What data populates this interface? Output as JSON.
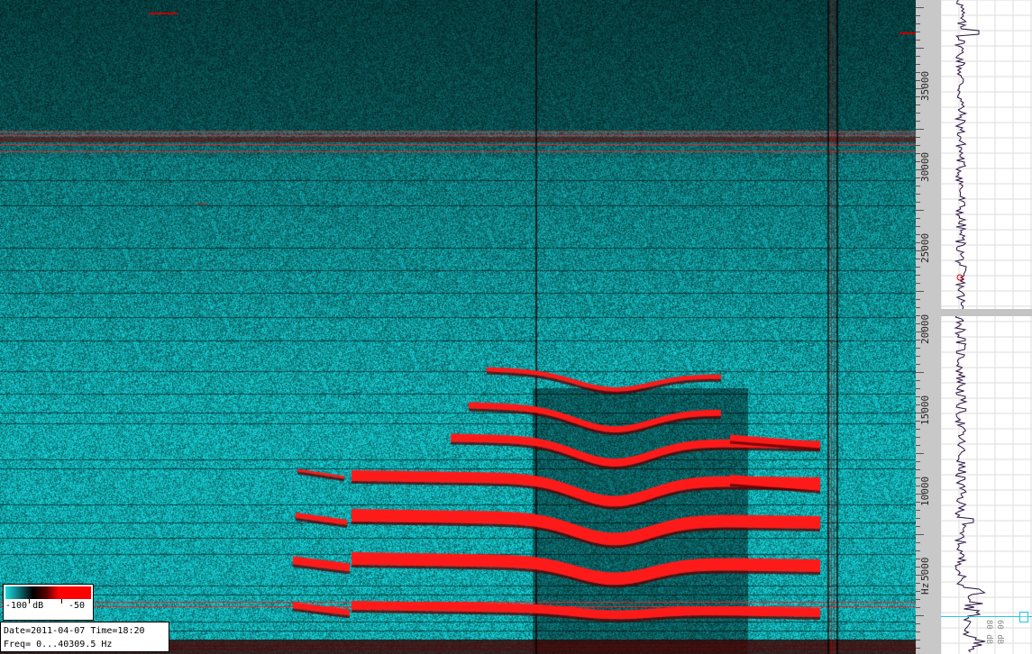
{
  "freq_scale": {
    "labels": [
      "35000",
      "30000",
      "25000",
      "20000",
      "15000",
      "10000",
      "5000"
    ],
    "unit": "Hz"
  },
  "legend": {
    "min_label": "-100 dB",
    "max_label": "-50",
    "colors": [
      "#1adfe0",
      "#0e7f85",
      "#000000",
      "#5a0000",
      "#ff0000"
    ]
  },
  "info": {
    "line1": "Date=2011-04-07 Time=18:20",
    "line2": "Freq= 0...40309.5 Hz"
  },
  "spectrum_panel": {
    "db_labels": [
      "60 dB",
      "80 dB"
    ]
  },
  "colors": {
    "background_cyan": "#18b7bd",
    "noise_dark": "#0b3a3f",
    "signal_red": "#ff1a1a",
    "scale_gray": "#c8c8c8",
    "cursor": "#22c7e6"
  }
}
